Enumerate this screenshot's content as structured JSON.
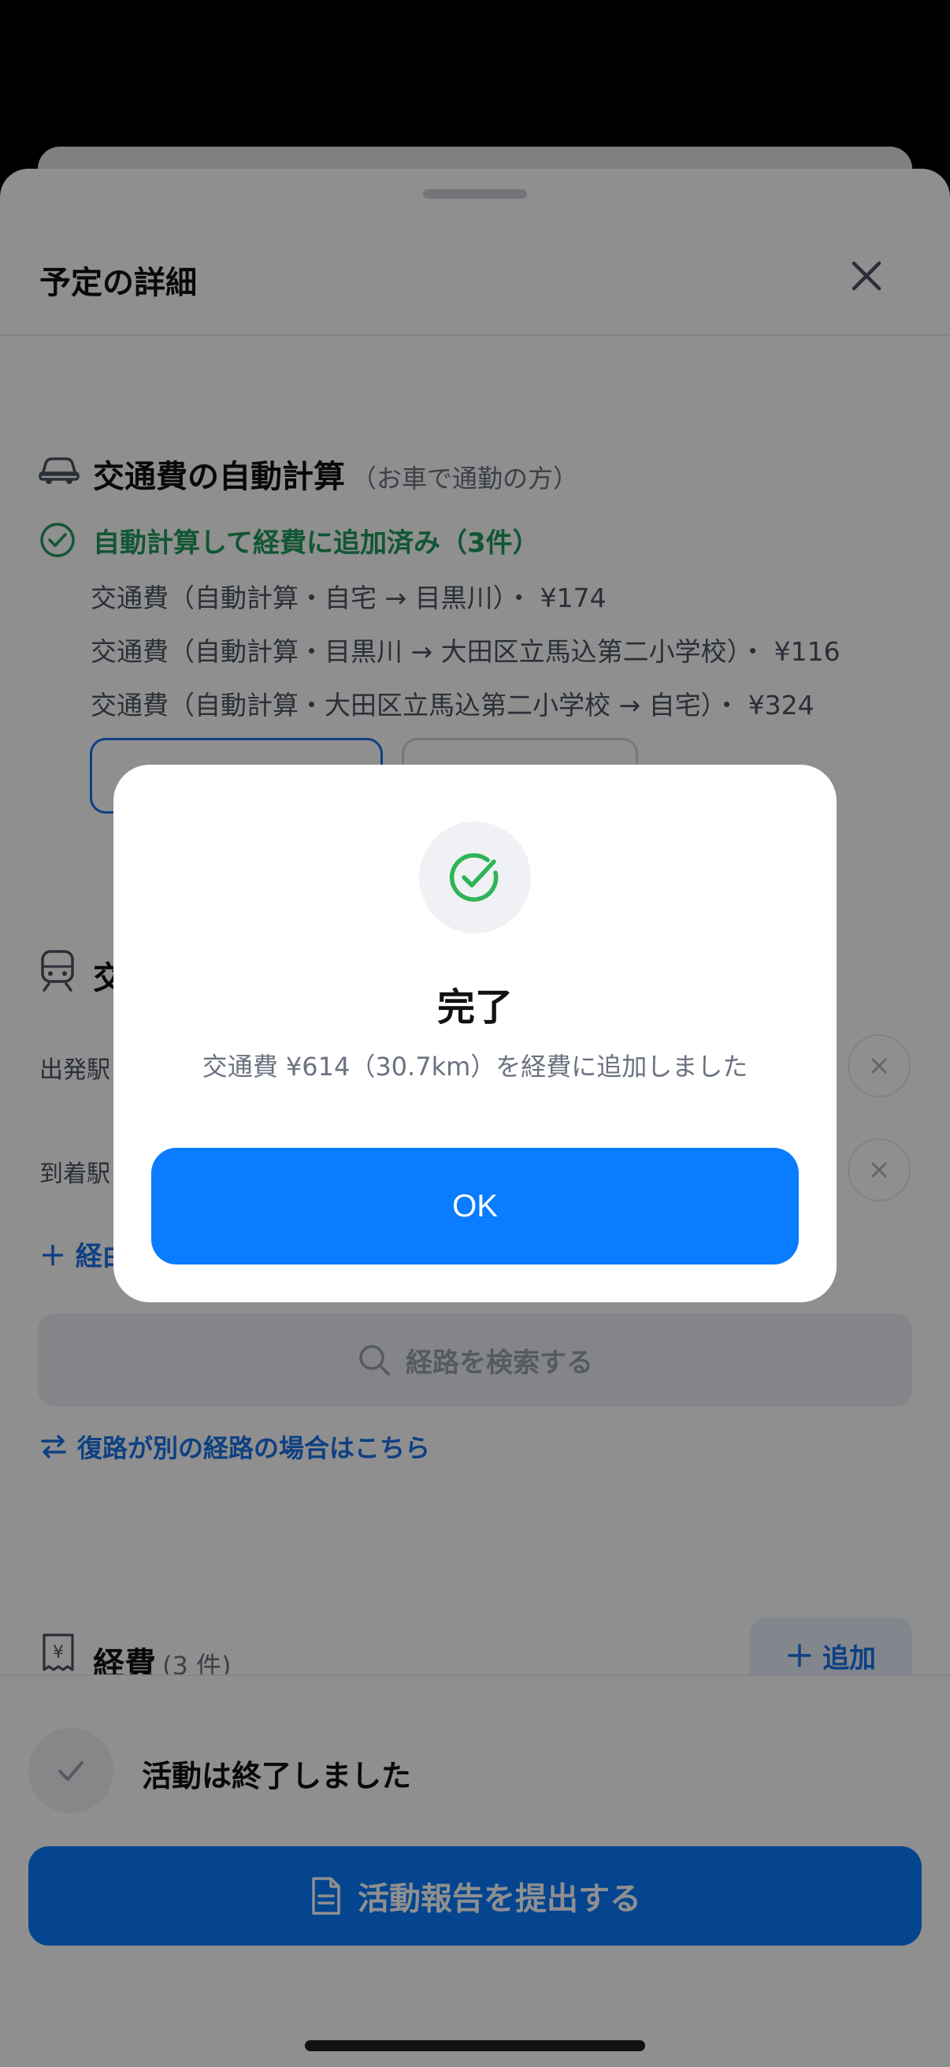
{
  "sheet": {
    "title": "予定の詳細"
  },
  "auto_calc": {
    "title": "交通費の自動計算",
    "subtitle": "（お車で通勤の方）",
    "status": "自動計算して経費に追加済み（3件）",
    "lines": [
      "交通費（自動計算・自宅 → 目黒川）・ ¥174",
      "交通費（自動計算・目黒川 → 大田区立馬込第二小学校）・ ¥116",
      "交通費（自動計算・大田区立馬込第二小学校 → 自宅）・ ¥324"
    ]
  },
  "transit": {
    "title": "交",
    "departure_label": "出発駅",
    "arrival_label": "到着駅",
    "add_route_label": "＋ 経由"
  },
  "search": {
    "label": "経路を検索する"
  },
  "return_route": {
    "label": "復路が別の経路の場合はこちら"
  },
  "expenses": {
    "title": "経費",
    "count": "(3 件)",
    "add_label": "追加"
  },
  "activity": {
    "done_text": "活動は終了しました",
    "submit_label": "活動報告を提出する"
  },
  "dialog": {
    "title": "完了",
    "message": "交通費 ¥614（30.7km）を経費に追加しました",
    "ok_label": "OK"
  },
  "colors": {
    "accent": "#0A7CFF",
    "success": "#1F9A5B",
    "overlay": "rgba(0,0,0,0.44)"
  }
}
